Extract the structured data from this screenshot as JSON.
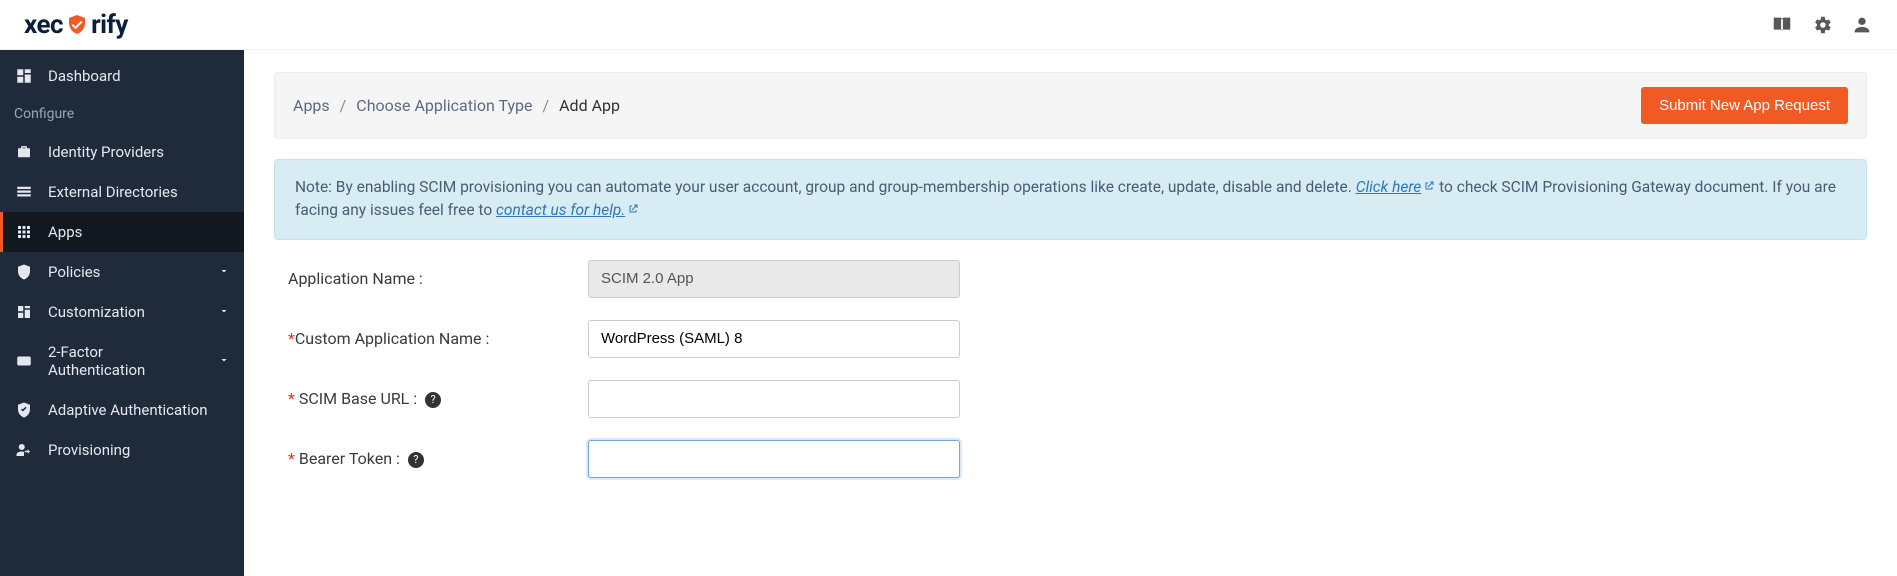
{
  "logo": {
    "prefix": "xec",
    "suffix": "rify"
  },
  "sidebar": {
    "dashboard": "Dashboard",
    "section_configure": "Configure",
    "items": [
      {
        "label": "Identity Providers"
      },
      {
        "label": "External Directories"
      },
      {
        "label": "Apps"
      },
      {
        "label": "Policies"
      },
      {
        "label": "Customization"
      },
      {
        "label": "2-Factor Authentication"
      },
      {
        "label": "Adaptive Authentication"
      },
      {
        "label": "Provisioning"
      }
    ]
  },
  "breadcrumb": {
    "apps": "Apps",
    "choose": "Choose Application Type",
    "add": "Add App"
  },
  "buttons": {
    "submit_new_app": "Submit New App Request"
  },
  "info": {
    "part1": "Note: By enabling SCIM provisioning you can automate your user account, group and group-membership operations like create, update, disable and delete. ",
    "click_here": "Click here",
    "part2": " to check SCIM Provisioning Gateway document. If you are facing any issues feel free to ",
    "contact_us": "contact us for help."
  },
  "form": {
    "application_name_label": "Application Name :",
    "application_name_value": "SCIM 2.0 App",
    "custom_app_name_label": "Custom Application Name :",
    "custom_app_name_value": "WordPress (SAML) 8",
    "scim_base_url_label": "SCIM Base URL :",
    "scim_base_url_value": "",
    "bearer_token_label": "Bearer Token :",
    "bearer_token_value": ""
  }
}
